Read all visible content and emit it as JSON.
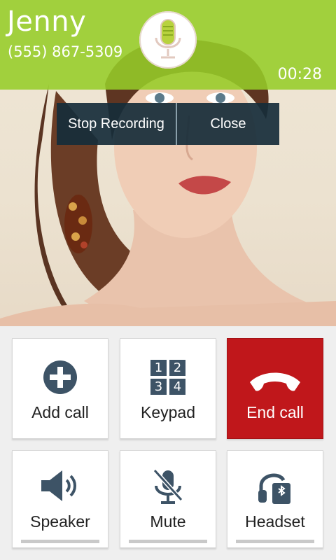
{
  "contact": {
    "name": "Jenny",
    "number": "(555) 867-5309",
    "duration": "00:28"
  },
  "recording_popup": {
    "stop_label": "Stop Recording",
    "close_label": "Close"
  },
  "actions": [
    {
      "label": "Add call",
      "icon": "add-call-icon"
    },
    {
      "label": "Keypad",
      "icon": "keypad-icon"
    },
    {
      "label": "End call",
      "icon": "end-call-icon"
    },
    {
      "label": "Speaker",
      "icon": "speaker-icon"
    },
    {
      "label": "Mute",
      "icon": "mute-icon"
    },
    {
      "label": "Headset",
      "icon": "bluetooth-headset-icon"
    }
  ],
  "keypad_digits": [
    "1",
    "2",
    "3",
    "4"
  ],
  "colors": {
    "header": "#96cd28",
    "end_call": "#c0171b",
    "icon": "#3d5366",
    "popup": "#162d3a"
  }
}
